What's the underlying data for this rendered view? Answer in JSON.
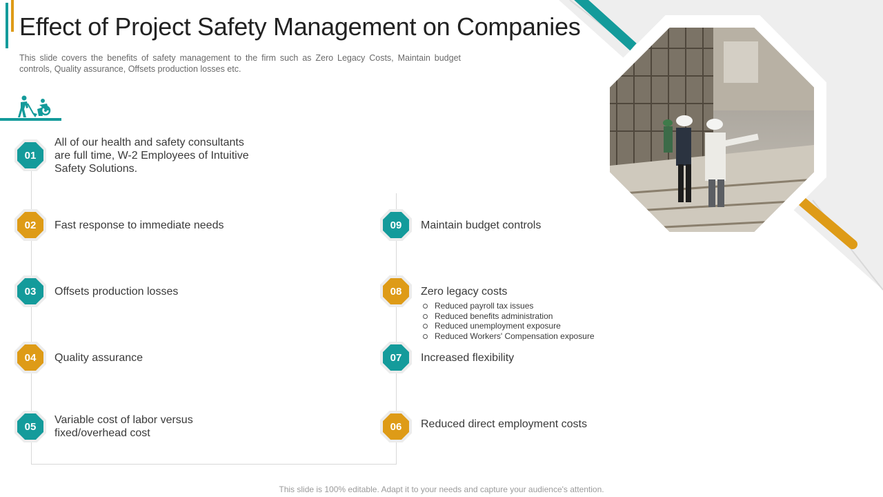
{
  "slide": {
    "title": "Effect of Project Safety Management on Companies",
    "subtitle": "This slide covers the benefits of safety management to the firm such as Zero Legacy Costs, Maintain budget controls, Quality assurance, Offsets production losses etc.",
    "footer": "This slide is 100% editable. Adapt it to your needs and capture your audience's attention."
  },
  "colors": {
    "teal": "#149B9B",
    "gold": "#DE9B17",
    "grey_corner": "#EEEEEE"
  },
  "icons": {
    "worker": "construction-workers-icon",
    "photo": "construction-site-photo"
  },
  "items_left": [
    {
      "num": "01",
      "text": "All of our health and safety consultants are full time, W-2 Employees of Intuitive  Safety Solutions.",
      "color": "teal"
    },
    {
      "num": "02",
      "text": "Fast response to immediate needs",
      "color": "gold"
    },
    {
      "num": "03",
      "text": "Offsets production losses",
      "color": "teal"
    },
    {
      "num": "04",
      "text": "Quality assurance",
      "color": "gold"
    },
    {
      "num": "05",
      "text": "Variable cost of labor versus fixed/overhead cost",
      "color": "teal"
    }
  ],
  "items_right": [
    {
      "num": "09",
      "text": "Maintain budget controls",
      "color": "teal"
    },
    {
      "num": "08",
      "text": "Zero legacy costs",
      "color": "gold",
      "subitems": [
        "Reduced payroll tax issues",
        "Reduced benefits administration",
        "Reduced unemployment exposure",
        "Reduced Workers' Compensation exposure"
      ]
    },
    {
      "num": "07",
      "text": "Increased flexibility",
      "color": "teal"
    },
    {
      "num": "06",
      "text": "Reduced direct employment costs",
      "color": "gold"
    }
  ]
}
